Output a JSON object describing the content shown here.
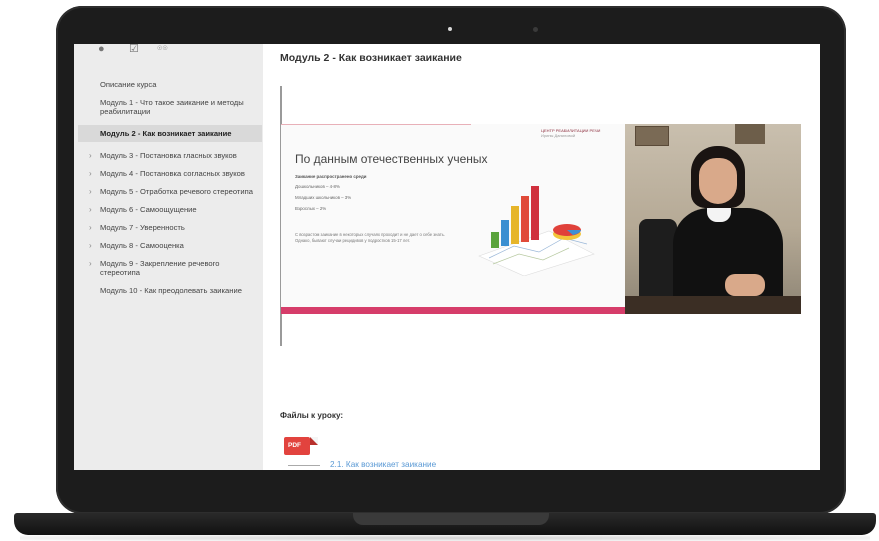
{
  "toolbar": {
    "icons": [
      "play-circle-icon",
      "checklist-icon",
      "glasses-icon"
    ],
    "glyphs": [
      "●",
      "☑",
      "☉☉"
    ]
  },
  "sidebar": {
    "items": [
      {
        "label": "Описание курса",
        "chevron": false
      },
      {
        "label": "Модуль 1 - Что такое заикание и методы реабилитации",
        "chevron": false
      },
      {
        "label": "Модуль 2 - Как возникает заикание",
        "chevron": false,
        "active": true
      },
      {
        "label": "Модуль 3 - Постановка гласных звуков",
        "chevron": true
      },
      {
        "label": "Модуль 4 - Постановка согласных звуков",
        "chevron": true
      },
      {
        "label": "Модуль 5 - Отработка речевого стереотипа",
        "chevron": true
      },
      {
        "label": "Модуль 6 - Самоощущение",
        "chevron": true
      },
      {
        "label": "Модуль 7 - Уверенность",
        "chevron": true
      },
      {
        "label": "Модуль 8 - Самооценка",
        "chevron": true
      },
      {
        "label": "Модуль 9 - Закрепление речевого стереотипа",
        "chevron": true
      },
      {
        "label": "Модуль 10 - Как преодолевать заикание",
        "chevron": false
      }
    ]
  },
  "main": {
    "title": "Модуль 2 - Как возникает заикание",
    "video": {
      "logo_line1": "ЦЕНТР РЕАБИЛИТАЦИИ РЕЧИ",
      "logo_line2": "Ирины Даниловой",
      "heading": "По данным отечественных ученых",
      "subheading": "Заикание распространено среди",
      "stats": [
        "Дошкольников – 4-8%",
        "Младших школьников – 3%",
        "Взрослых – 2%"
      ],
      "note": "С возрастом заикание в некоторых случаях проходит и не дает о себе знать. Однако, бывают случаи рецидивов у подростков 15-17 лет."
    },
    "files_title": "Файлы к уроку:",
    "file_badge": "PDF",
    "file_link": "2.1. Как возникает заикание"
  },
  "colors": {
    "accent_pink": "#d63d6a",
    "pdf_red": "#e2433e",
    "link_blue": "#5b9ad5",
    "sidebar_bg": "#ececec"
  }
}
